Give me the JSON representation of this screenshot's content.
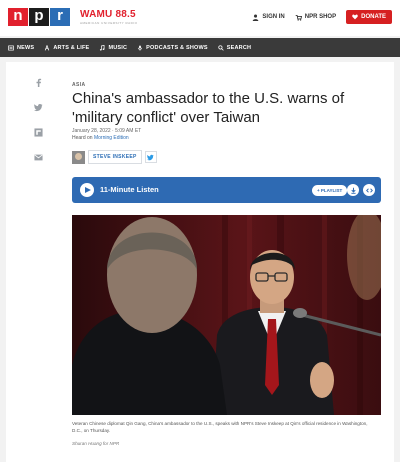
{
  "header": {
    "logo_letters": [
      "n",
      "p",
      "r"
    ],
    "station_name": "WAMU 88.5",
    "station_tagline": "AMERICAN UNIVERSITY RADIO",
    "sign_in": "SIGN IN",
    "shop": "NPR SHOP",
    "donate": "DONATE"
  },
  "nav": {
    "items": [
      {
        "label": "NEWS",
        "icon": "news-icon"
      },
      {
        "label": "ARTS & LIFE",
        "icon": "arts-icon"
      },
      {
        "label": "MUSIC",
        "icon": "music-icon"
      },
      {
        "label": "PODCASTS & SHOWS",
        "icon": "podcast-icon"
      },
      {
        "label": "SEARCH",
        "icon": "search-icon"
      }
    ]
  },
  "share": [
    "facebook-icon",
    "twitter-icon",
    "flipboard-icon",
    "email-icon"
  ],
  "article": {
    "section": "ASIA",
    "headline": "China's ambassador to the U.S. warns of 'military conflict' over Taiwan",
    "date": "January 28, 2022 · 5:09 AM ET",
    "heard_prefix": "Heard on ",
    "heard_show": "Morning Edition",
    "author": "STEVE INSKEEP"
  },
  "player": {
    "title": "11-Minute Listen",
    "playlist": "+ PLAYLIST"
  },
  "photo": {
    "caption": "Veteran Chinese diplomat Qin Gang, China's ambassador to the U.S., speaks with NPR's Steve Inskeep at Qin's official residence in Washington, D.C., on Thursday.",
    "credit": "Shuran Huang for NPR"
  },
  "colors": {
    "npr_red": "#e1202d",
    "npr_blue": "#2b6db5",
    "player_blue": "#2e6ab3",
    "nav_dark": "#3a3a3a"
  }
}
